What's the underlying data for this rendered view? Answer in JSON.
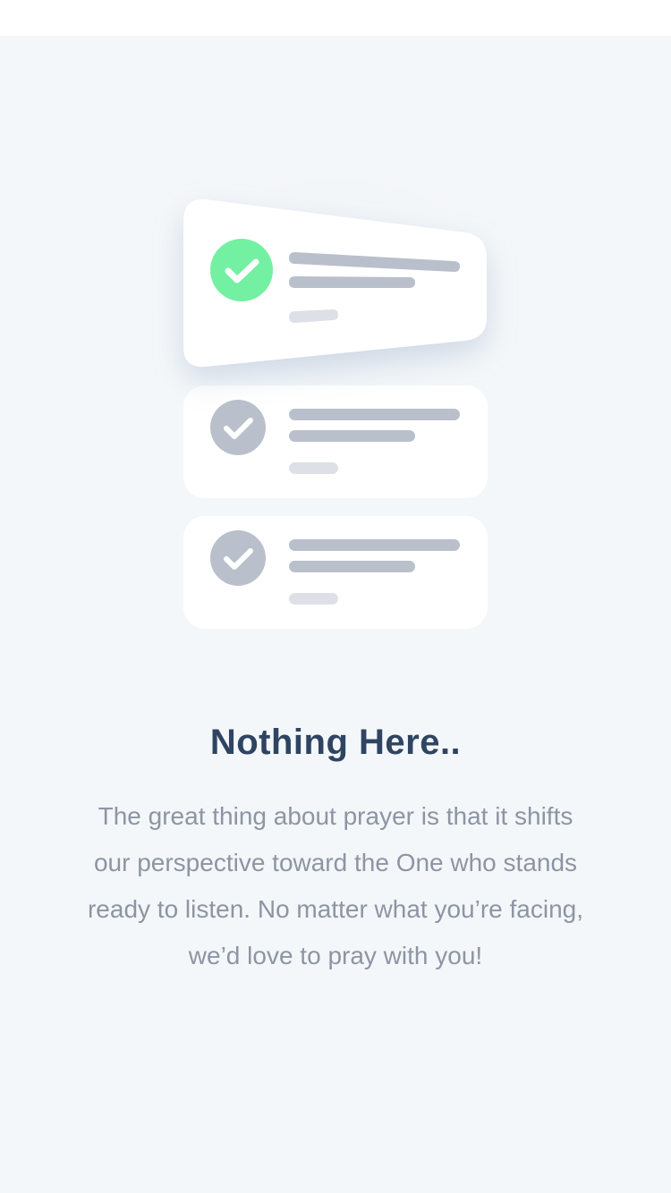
{
  "empty_state": {
    "title": "Nothing Here..",
    "message": "The great thing about prayer is that it shifts our perspective toward the One who stands ready to listen. No matter what you’re facing, we’d love to pray with you!"
  },
  "illustration": {
    "icons": [
      "check-circle-icon",
      "check-circle-icon",
      "check-circle-icon"
    ]
  },
  "colors": {
    "background": "#f4f7f9",
    "title": "#2f4461",
    "message": "#8d95a4",
    "accent_green": "#74f0a3",
    "muted_gray": "#b9c0cb"
  }
}
